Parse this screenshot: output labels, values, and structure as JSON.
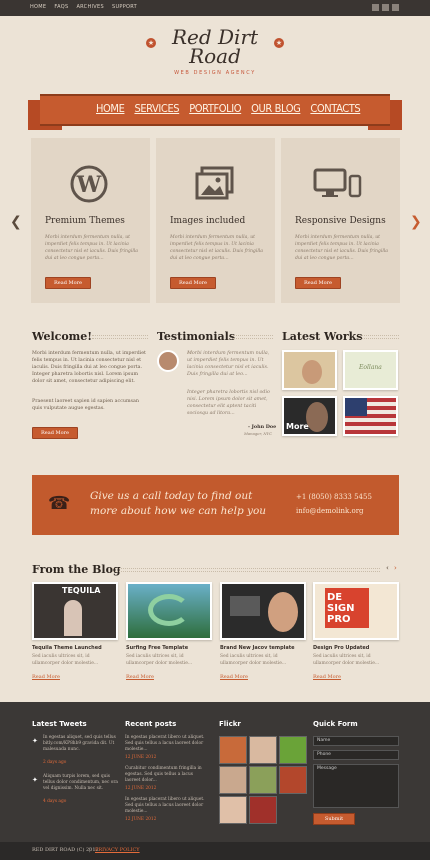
{
  "topnav": [
    "HOME",
    "FAQS",
    "ARCHIVES",
    "SUPPORT"
  ],
  "social_icons": [
    "facebook-icon",
    "twitter-icon",
    "rss-icon"
  ],
  "logo": {
    "line1": "Red Dirt",
    "line2": "Road",
    "tagline": "WEB DESIGN AGENCY"
  },
  "nav": [
    "HOME",
    "SERVICES",
    "PORTFOLIO",
    "OUR BLOG",
    "CONTACTS"
  ],
  "features": [
    {
      "icon": "wordpress-icon",
      "title": "Premium Themes",
      "text": "Morbi interdum fermentum nulla, ut imperdiet felis tempus in. Ut lacinia consectetur nisl et iaculis. Duis fringilla dui at leo congue porta...",
      "button": "Read More"
    },
    {
      "icon": "images-icon",
      "title": "Images included",
      "text": "Morbi interdum fermentum nulla, ut imperdiet felis tempus in. Ut lacinia consectetur nisl et iaculis. Duis fringilla dui at leo congue porta...",
      "button": "Read More"
    },
    {
      "icon": "devices-icon",
      "title": "Responsive Designs",
      "text": "Morbi interdum fermentum nulla, ut imperdiet felis tempus in. Ut lacinia consectetur nisl et iaculis. Duis fringilla dui at leo congue porta...",
      "button": "Read More"
    }
  ],
  "welcome": {
    "title": "Welcome!",
    "p1": "Morbi interdum fermentum nulla, ut imperdiet felis tempus in. Ut lacinia consectetur nisl et iaculis. Duis fringilla dui at leo congue porta. Integer pharetra lobortis nisl. Lorem ipsum dolor sit amet, consectetur adipiscing elit.",
    "p2": "Praesent laoreet sapien id sapien accumsan quis vulputate augue egestas.",
    "button": "Read More"
  },
  "testimonials": {
    "title": "Testimonials",
    "quote1": "Morbi interdum fermentum nulla, ut imperdiet felis tempus in. Ut lacinia consectetur nisl et iaculis. Duis fringilla dui at leo...",
    "quote2": "Integer pharetra lobortis nisl odio nisi. Lorem ipsum dolor sit amet, consectetur elit aptent taciti sociosqu ad litora...",
    "author": "- John Doe",
    "role": "Manager, NYC"
  },
  "works": {
    "title": "Latest Works",
    "items": [
      "More",
      "Eollana"
    ]
  },
  "call": {
    "text": "Give us a call today to find out more about how we can help you",
    "phone": "+1 (8050) 8333 5455",
    "email": "info@demolink.org"
  },
  "blog": {
    "title": "From the Blog",
    "posts": [
      {
        "img_caption": "TEQUILA",
        "title": "Tequila Theme Launched",
        "text": "Sed iaculis ultrices sit, id ullamcorper dolor molestie...",
        "more": "Read More"
      },
      {
        "img_caption": "",
        "title": "Surfing Free Template",
        "text": "Sed iaculis ultrices sit, id ullamcorper dolor molestie...",
        "more": "Read More"
      },
      {
        "img_caption": "",
        "title": "Brand New Jacov template",
        "text": "Sed iaculis ultrices sit, id ullamcorper dolor molestie...",
        "more": "Read More"
      },
      {
        "img_caption": "DE SIGN PRO",
        "title": "Design Pro Updated",
        "text": "Sed iaculis ultrices sit, id ullamcorper dolor molestie...",
        "more": "Read More"
      }
    ]
  },
  "footer": {
    "tweets_title": "Latest Tweets",
    "tweets": [
      {
        "text": "In egestas aliquet, sed quis tellus bitly.com/KP8hb9 gravida dit. Ut malesuada nunc.",
        "date": "2 days ago"
      },
      {
        "text": "Aliquam turpis lorem, sed quis tellus dolor condimentum, nec ora vel dignissim. Nulla nec sit.",
        "date": "4 days ago"
      }
    ],
    "posts_title": "Recent posts",
    "posts": [
      {
        "text": "In egestas placerat libero ut aliquet. Sed quis tellus a lacus laoreet dolor molestie...",
        "date": "12 JUNE 2012"
      },
      {
        "text": "Curabitur condimentum fringilla in egestas. Sed quis tellus a lacus laoreet dolor...",
        "date": "12 JUNE 2012"
      },
      {
        "text": "In egestas placerat libero ut aliquet. Sed quis tellus a lacus laoreet dolor molestie...",
        "date": "12 JUNE 2012"
      }
    ],
    "flickr_title": "Flickr",
    "form_title": "Quick Form",
    "form": {
      "name": "Name",
      "phone": "Phone",
      "message": "Message",
      "submit": "Submit"
    },
    "copyright": "RED DIRT ROAD (C) 2012",
    "privacy": "PRIVACY POLICY"
  }
}
